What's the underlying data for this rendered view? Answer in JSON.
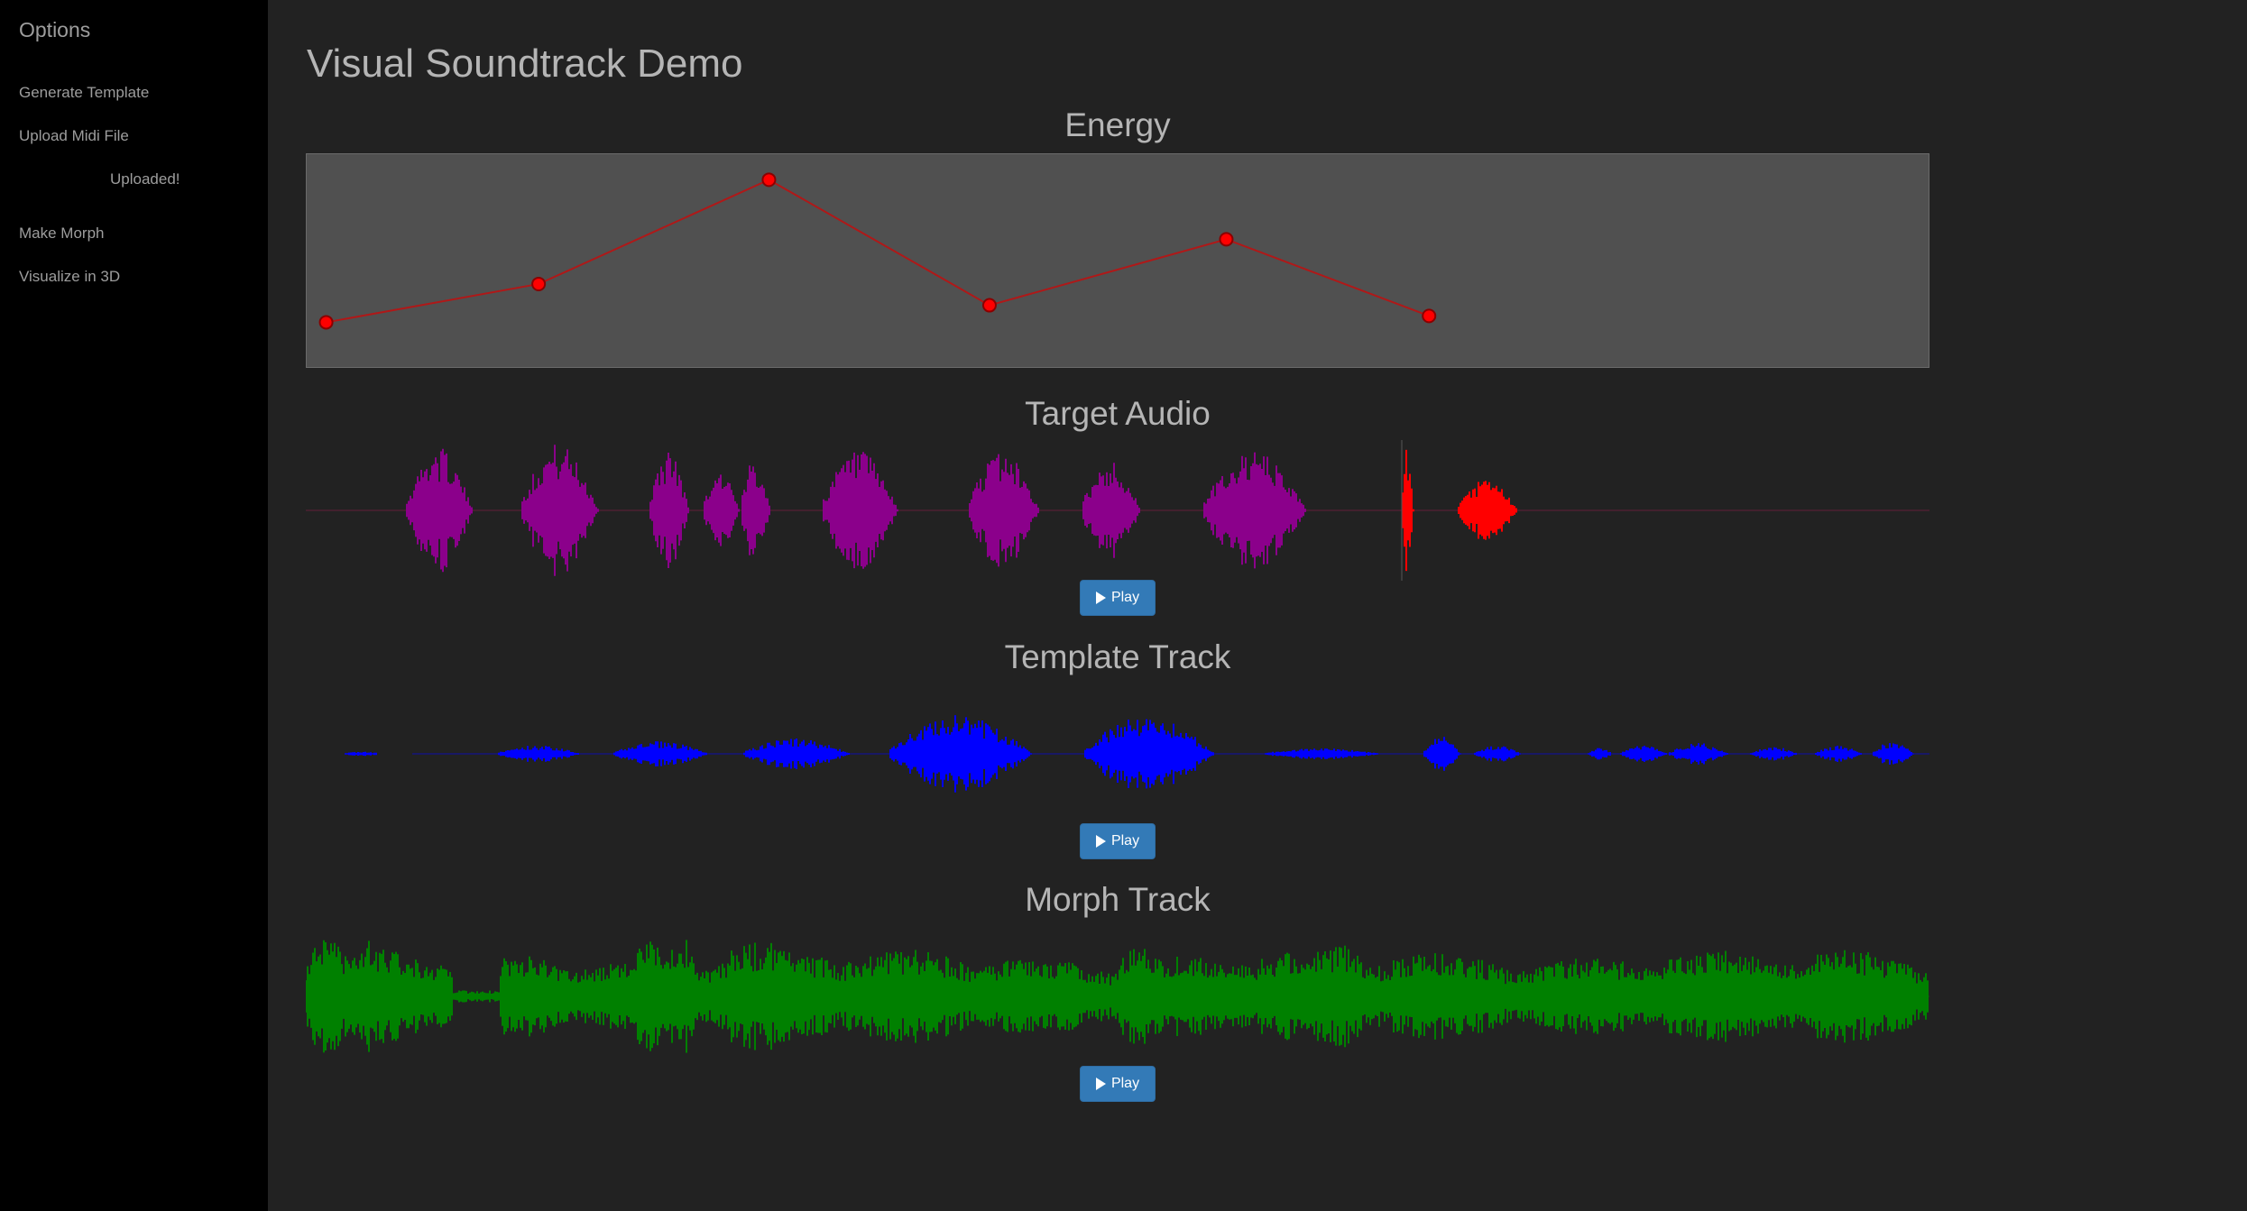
{
  "sidebar": {
    "title": "Options",
    "items": [
      {
        "label": "Generate Template"
      },
      {
        "label": "Upload Midi File"
      },
      {
        "label": "Make Morph"
      },
      {
        "label": "Visualize in 3D"
      }
    ],
    "upload_status": "Uploaded!"
  },
  "main": {
    "title": "Visual Soundtrack Demo",
    "energy": {
      "heading": "Energy",
      "line_color": "#b01818",
      "point_color": "#ff0000",
      "points": [
        {
          "t": 0.012,
          "level": 0.21
        },
        {
          "t": 0.143,
          "level": 0.39
        },
        {
          "t": 0.285,
          "level": 0.88
        },
        {
          "t": 0.421,
          "level": 0.29
        },
        {
          "t": 0.567,
          "level": 0.6
        },
        {
          "t": 0.692,
          "level": 0.24
        }
      ]
    },
    "target_audio": {
      "heading": "Target Audio",
      "play_label": "Play",
      "color": "#8b008b",
      "highlight_color": "#ff0000",
      "progress": 0.675
    },
    "template_track": {
      "heading": "Template Track",
      "play_label": "Play",
      "color": "#0000ff"
    },
    "morph_track": {
      "heading": "Morph Track",
      "play_label": "Play",
      "color": "#008000"
    }
  }
}
